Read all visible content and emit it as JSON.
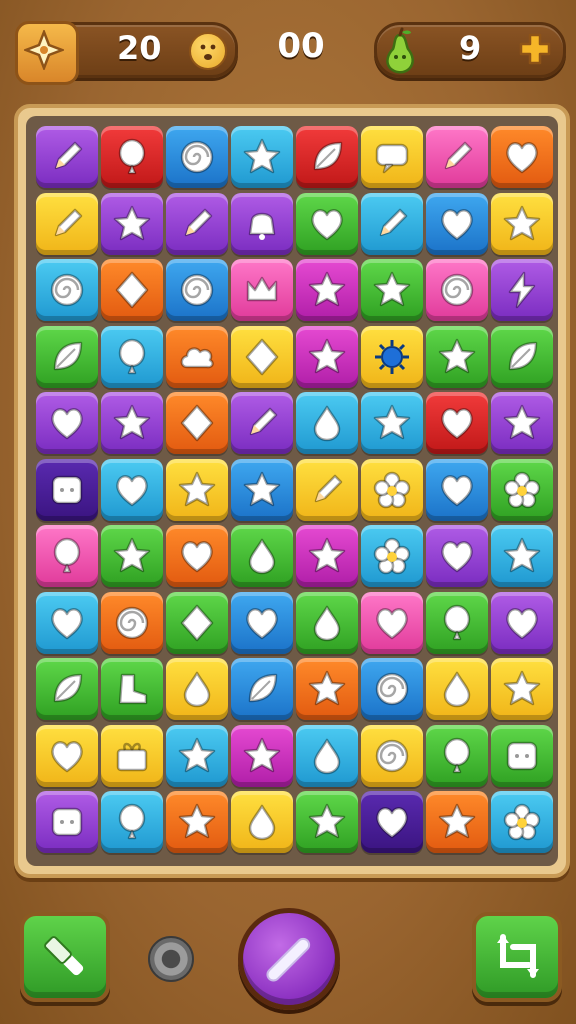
{
  "hud": {
    "score": "20",
    "timer": "00",
    "fruit_count": "9",
    "left_badge_icon": "compass-star-icon",
    "mood_icon": "worried-face-icon",
    "fruit_icon": "pear-icon",
    "add_icon": "plus-icon"
  },
  "board": {
    "columns": 8,
    "rows": 11,
    "tiles": [
      [
        [
          "purple",
          "pencil"
        ],
        [
          "red",
          "balloon"
        ],
        [
          "blue",
          "spiral"
        ],
        [
          "cyan",
          "star"
        ],
        [
          "red",
          "leaf"
        ],
        [
          "yellow",
          "bubble"
        ],
        [
          "pink",
          "pencil"
        ],
        [
          "orange",
          "heart"
        ]
      ],
      [
        [
          "yellow",
          "pencil"
        ],
        [
          "purple",
          "star"
        ],
        [
          "purple",
          "pencil"
        ],
        [
          "purple",
          "bell"
        ],
        [
          "green",
          "heart"
        ],
        [
          "cyan",
          "pencil"
        ],
        [
          "blue",
          "heart"
        ],
        [
          "yellow",
          "star"
        ]
      ],
      [
        [
          "cyan",
          "spiral"
        ],
        [
          "orange",
          "diamond"
        ],
        [
          "blue",
          "spiral"
        ],
        [
          "pink",
          "crown"
        ],
        [
          "magenta",
          "star"
        ],
        [
          "green",
          "star"
        ],
        [
          "pink",
          "spiral"
        ],
        [
          "purple",
          "bolt"
        ]
      ],
      [
        [
          "green",
          "leaf"
        ],
        [
          "cyan",
          "balloon"
        ],
        [
          "orange",
          "cloud"
        ],
        [
          "yellow",
          "diamond"
        ],
        [
          "magenta",
          "star"
        ],
        [
          "yellow",
          "sun"
        ],
        [
          "green",
          "star"
        ],
        [
          "green",
          "leaf"
        ]
      ],
      [
        [
          "purple",
          "heart"
        ],
        [
          "purple",
          "star"
        ],
        [
          "orange",
          "diamond"
        ],
        [
          "purple",
          "pencil"
        ],
        [
          "cyan",
          "drop"
        ],
        [
          "cyan",
          "star"
        ],
        [
          "red",
          "heart"
        ],
        [
          "purple",
          "star"
        ]
      ],
      [
        [
          "indigo",
          "block"
        ],
        [
          "cyan",
          "heart"
        ],
        [
          "yellow",
          "star"
        ],
        [
          "blue",
          "star"
        ],
        [
          "yellow",
          "pencil"
        ],
        [
          "yellow",
          "flower"
        ],
        [
          "blue",
          "heart"
        ],
        [
          "green",
          "flower"
        ]
      ],
      [
        [
          "pink",
          "balloon"
        ],
        [
          "green",
          "star"
        ],
        [
          "orange",
          "heart"
        ],
        [
          "green",
          "drop"
        ],
        [
          "magenta",
          "star"
        ],
        [
          "cyan",
          "flower"
        ],
        [
          "purple",
          "heart"
        ],
        [
          "cyan",
          "star"
        ]
      ],
      [
        [
          "cyan",
          "heart"
        ],
        [
          "orange",
          "spiral"
        ],
        [
          "green",
          "diamond"
        ],
        [
          "blue",
          "heart"
        ],
        [
          "green",
          "drop"
        ],
        [
          "pink",
          "heart"
        ],
        [
          "green",
          "balloon"
        ],
        [
          "purple",
          "heart"
        ]
      ],
      [
        [
          "green",
          "leaf"
        ],
        [
          "green",
          "boot"
        ],
        [
          "yellow",
          "drop"
        ],
        [
          "blue",
          "leaf"
        ],
        [
          "orange",
          "star"
        ],
        [
          "blue",
          "spiral"
        ],
        [
          "yellow",
          "drop"
        ],
        [
          "yellow",
          "star"
        ]
      ],
      [
        [
          "yellow",
          "heart"
        ],
        [
          "yellow",
          "gift"
        ],
        [
          "cyan",
          "star"
        ],
        [
          "magenta",
          "star"
        ],
        [
          "cyan",
          "drop"
        ],
        [
          "yellow",
          "spiral"
        ],
        [
          "green",
          "balloon"
        ],
        [
          "green",
          "block"
        ]
      ],
      [
        [
          "purple",
          "block"
        ],
        [
          "cyan",
          "balloon"
        ],
        [
          "orange",
          "star"
        ],
        [
          "yellow",
          "drop"
        ],
        [
          "green",
          "star"
        ],
        [
          "indigo",
          "heart"
        ],
        [
          "orange",
          "star"
        ],
        [
          "cyan",
          "flower"
        ]
      ]
    ]
  },
  "palette": {
    "purple": [
      "#b05ce6",
      "#7a2cc0"
    ],
    "red": [
      "#f23b3b",
      "#c01818"
    ],
    "blue": [
      "#3fa8f0",
      "#1b72c8"
    ],
    "cyan": [
      "#4ccbf2",
      "#1f98d0"
    ],
    "yellow": [
      "#ffe040",
      "#f0b418"
    ],
    "pink": [
      "#ff78c8",
      "#e03a9a"
    ],
    "orange": [
      "#ff8a2a",
      "#e25a10"
    ],
    "green": [
      "#5fd84a",
      "#2fa022"
    ],
    "magenta": [
      "#e64ad2",
      "#b01ea8"
    ],
    "indigo": [
      "#5a2ab0",
      "#3a1480"
    ]
  },
  "controls": {
    "hammer_button_icon": "hammer-icon",
    "coin_icon": "coin-icon",
    "main_button_icon": "wand-icon",
    "swap_button_icon": "swap-tiles-icon"
  }
}
